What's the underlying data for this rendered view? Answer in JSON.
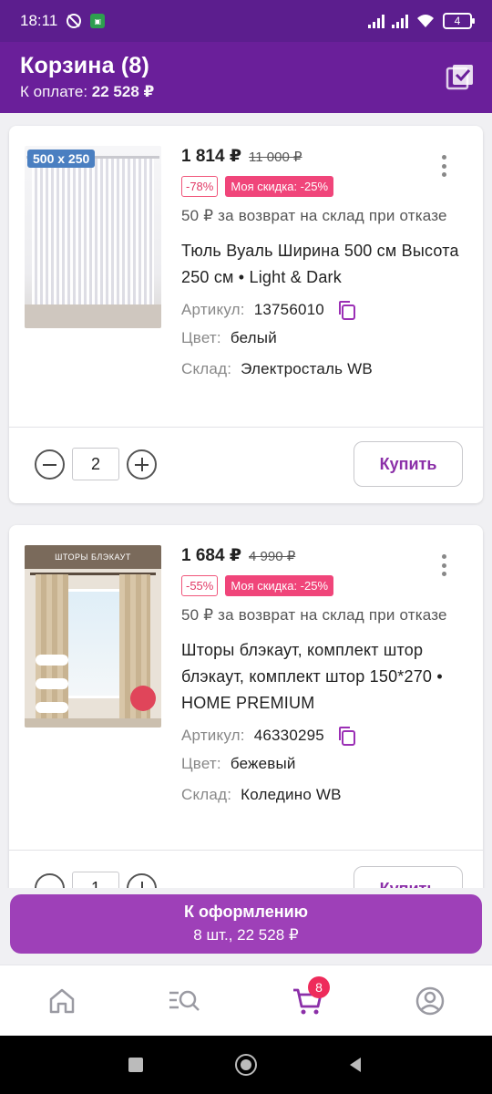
{
  "status_bar": {
    "time": "18:11",
    "battery": "4"
  },
  "header": {
    "title": "Корзина (8)",
    "pay_label": "К оплате:",
    "pay_value": "22 528 ₽"
  },
  "items": [
    {
      "price": "1 814 ₽",
      "old_price": "11 000 ₽",
      "discount": "-78%",
      "my_discount": "Моя скидка: -25%",
      "return_note": "50 ₽ за возврат на склад при отказе",
      "name": "Тюль Вуаль Ширина 500 см Высота 250 см • Light & Dark",
      "article_label": "Артикул:",
      "article": "13756010",
      "color_label": "Цвет:",
      "color": "белый",
      "warehouse_label": "Склад:",
      "warehouse": "Электросталь WB",
      "quantity": "2",
      "buy_label": "Купить",
      "image_tag": "500 x 250"
    },
    {
      "price": "1 684 ₽",
      "old_price": "4 990 ₽",
      "discount": "-55%",
      "my_discount": "Моя скидка: -25%",
      "return_note": "50 ₽ за возврат на склад при отказе",
      "name": "Шторы блэкаут, комплект штор блэкаут, комплект штор 150*270 • HOME PREMIUM",
      "article_label": "Артикул:",
      "article": "46330295",
      "color_label": "Цвет:",
      "color": "бежевый",
      "warehouse_label": "Склад:",
      "warehouse": "Коледино WB",
      "quantity": "1",
      "buy_label": "Купить",
      "image_tag": "ШТОРЫ БЛЭКАУТ"
    }
  ],
  "checkout": {
    "label": "К оформлению",
    "summary": "8 шт., 22 528 ₽"
  },
  "nav": {
    "cart_count": "8",
    "items": [
      "home-icon",
      "catalog-search-icon",
      "cart-icon",
      "profile-icon"
    ],
    "active_color": "#8b2fa8"
  },
  "colors": {
    "brand": "#6a1f9a",
    "accent": "#9e40b8",
    "sale": "#f0457a"
  }
}
